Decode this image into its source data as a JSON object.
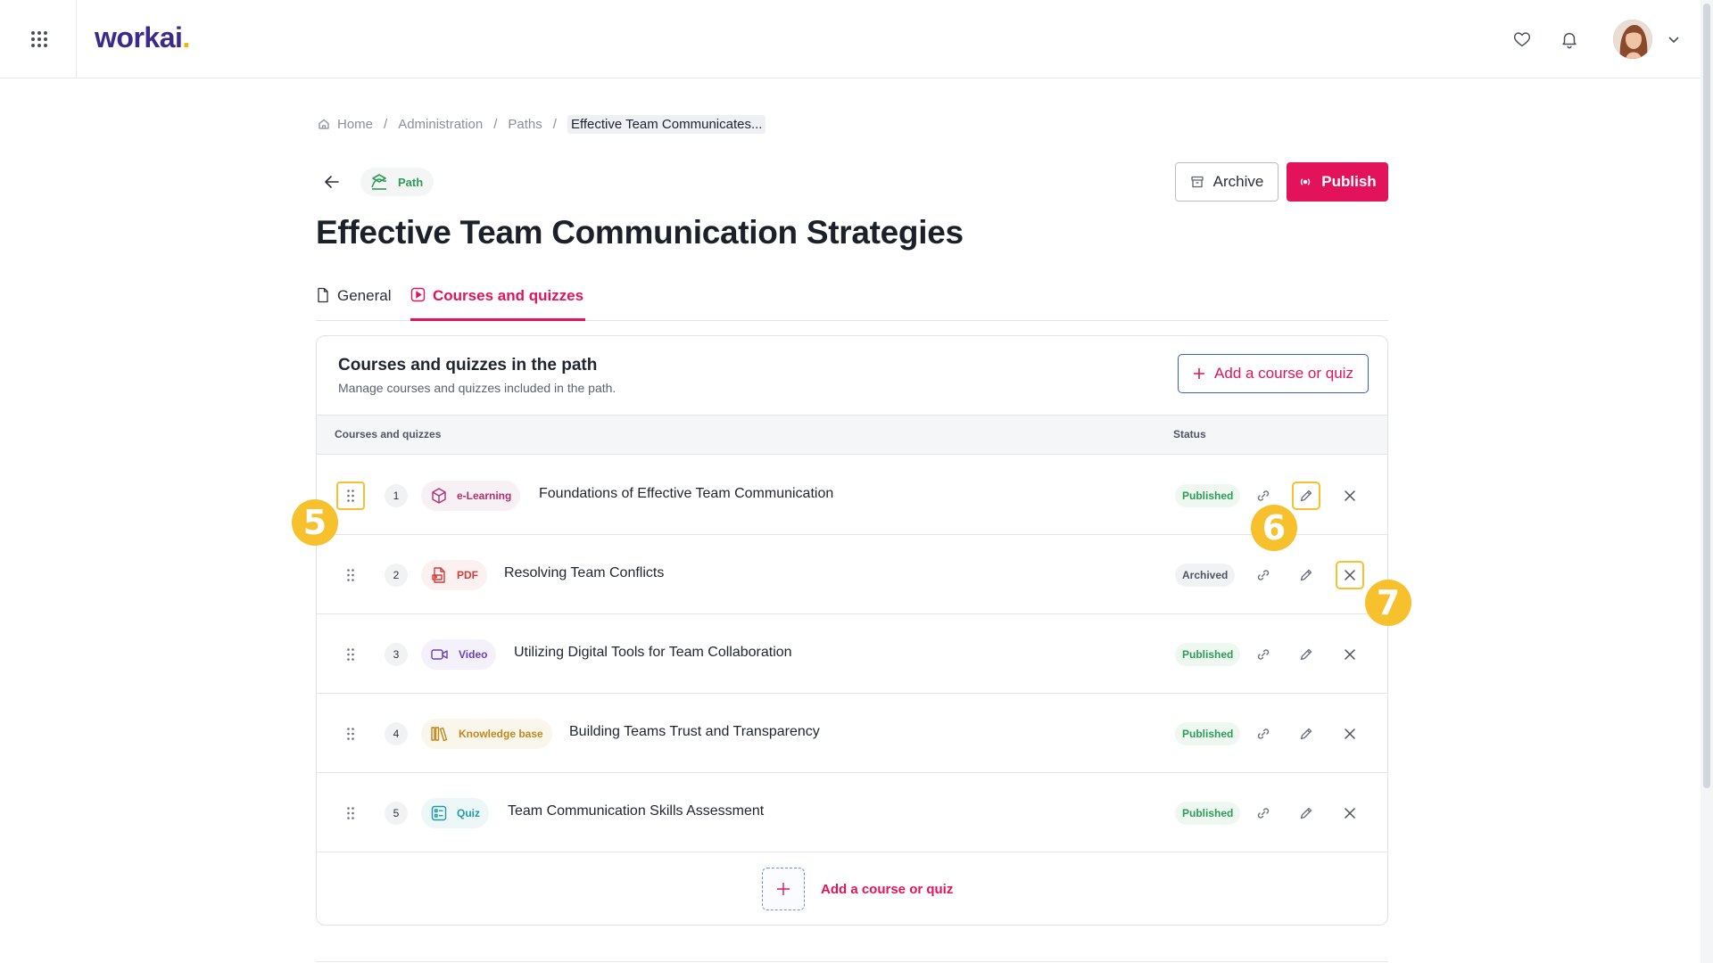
{
  "app": {
    "logo_text": "workai",
    "logo_dot": "."
  },
  "breadcrumb": {
    "items": [
      "Home",
      "Administration",
      "Paths"
    ],
    "current": "Effective Team Communicates...",
    "separator": "/"
  },
  "header": {
    "chip_label": "Path",
    "archive_label": "Archive",
    "publish_label": "Publish",
    "title": "Effective Team Communication Strategies"
  },
  "tabs": [
    {
      "label": "General"
    },
    {
      "label": "Courses and quizzes",
      "active": true
    }
  ],
  "card": {
    "title": "Courses and quizzes in the path",
    "subtitle": "Manage courses and quizzes included in the path.",
    "add_label": "Add a course or quiz",
    "columns": [
      "Courses and quizzes",
      "Status"
    ],
    "rows": [
      {
        "num": "1",
        "type": "e-Learning",
        "title": "Foundations of Effective Team Communication",
        "status": "Published"
      },
      {
        "num": "2",
        "type": "PDF",
        "title": "Resolving Team Conflicts",
        "status": "Archived"
      },
      {
        "num": "3",
        "type": "Video",
        "title": "Utilizing Digital Tools for Team Collaboration",
        "status": "Published"
      },
      {
        "num": "4",
        "type": "Knowledge base",
        "title": "Building Teams Trust and Transparency",
        "status": "Published"
      },
      {
        "num": "5",
        "type": "Quiz",
        "title": "Team Communication Skills Assessment",
        "status": "Published"
      }
    ],
    "add_bottom_label": "Add a course or quiz"
  },
  "callouts": [
    "5",
    "6",
    "7"
  ],
  "colors": {
    "accent": "#e3135b",
    "brand": "#3b2a8c",
    "highlight": "#f6c12d",
    "published": "#2e9c58",
    "outline": "#3a5fc8"
  },
  "icons": {
    "type_icons": [
      "cube-icon",
      "pdf-icon",
      "video-icon",
      "books-icon",
      "quiz-list-icon"
    ],
    "actions": [
      "link-icon",
      "pencil-icon",
      "close-icon"
    ]
  }
}
